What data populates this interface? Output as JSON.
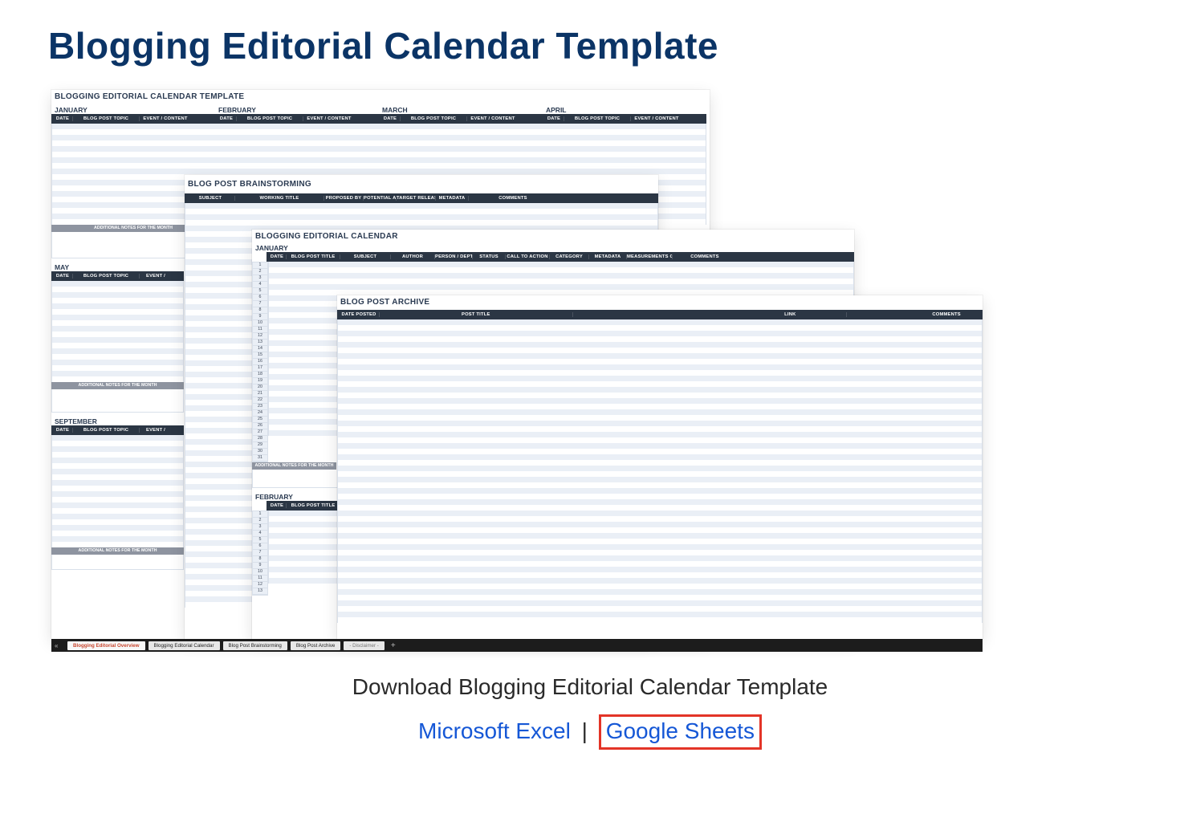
{
  "page": {
    "heading": "Blogging Editorial Calendar Template",
    "download_caption": "Download Blogging Editorial Calendar Template",
    "link_excel": "Microsoft Excel",
    "link_sheets": "Google Sheets",
    "link_sep": "|"
  },
  "tabs": {
    "nav_left": "«",
    "active": "Blogging Editorial Overview",
    "tab2": "Blogging Editorial Calendar",
    "tab3": "Blog Post Brainstorming",
    "tab4": "Blog Post Archive",
    "tab5": "- Disclaimer -",
    "plus": "+"
  },
  "overview": {
    "title": "BLOGGING EDITORIAL CALENDAR TEMPLATE",
    "months4": [
      "JANUARY",
      "FEBRUARY",
      "MARCH",
      "APRIL"
    ],
    "month5": "MAY",
    "month9": "SEPTEMBER",
    "col_date": "DATE",
    "col_topic": "BLOG POST TOPIC",
    "col_eventcontent": "EVENT / CONTENT",
    "col_event_short": "EVENT / ",
    "notes_label": "ADDITIONAL NOTES FOR THE MONTH"
  },
  "brainstorm": {
    "title": "BLOG POST BRAINSTORMING",
    "col_subject": "SUBJECT",
    "col_working_title": "WORKING TITLE",
    "col_proposed_by": "PROPOSED BY",
    "col_potential_author": "POTENTIAL AUTHOR",
    "col_target_release_date": "TARGET RELEASE DATE",
    "col_metadata": "METADATA",
    "col_comments": "COMMENTS"
  },
  "editorial": {
    "title": "BLOGGING EDITORIAL CALENDAR",
    "month1": "JANUARY",
    "month2": "FEBRUARY",
    "col_date": "DATE",
    "col_post_title": "BLOG POST TITLE",
    "col_subject": "SUBJECT",
    "col_author": "AUTHOR",
    "col_person_dept": "PERSON / DEPT RESPONSIBLE",
    "col_status": "STATUS",
    "col_cta": "CALL TO ACTION",
    "col_category": "CATEGORY",
    "col_metadata": "METADATA",
    "col_mos": "MEASUREMENTS OF SUCCESS",
    "col_comments": "COMMENTS",
    "row_idx": [
      "1",
      "2",
      "3",
      "4",
      "5",
      "6",
      "7",
      "8",
      "9",
      "10",
      "11",
      "12",
      "13",
      "14",
      "15",
      "16",
      "17",
      "18",
      "19",
      "20",
      "21",
      "22",
      "23",
      "24",
      "25",
      "26",
      "27",
      "28",
      "29",
      "30",
      "31"
    ],
    "notes_label": "ADDITIONAL NOTES FOR THE MONTH",
    "row_idx2": [
      "1",
      "2",
      "3",
      "4",
      "5",
      "6",
      "7",
      "8",
      "9",
      "10",
      "11",
      "12",
      "13"
    ]
  },
  "archive": {
    "title": "BLOG POST ARCHIVE",
    "col_date_posted": "DATE POSTED",
    "col_post_title": "POST TITLE",
    "col_link": "LINK",
    "col_comments": "COMMENTS"
  }
}
